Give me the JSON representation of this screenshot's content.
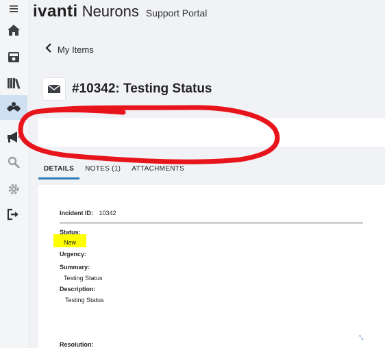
{
  "header": {
    "logo_text": "ivanti",
    "product": "Neurons",
    "portal": "Support Portal"
  },
  "nav": {
    "back_label": "My Items"
  },
  "incident": {
    "title": "#10342: Testing Status",
    "id_label": "Incident ID:",
    "id_value": "10342",
    "status_label": "Status:",
    "status_value": "New",
    "urgency_label": "Urgency:",
    "summary_label": "Summary:",
    "summary_value": "Testing Status",
    "description_label": "Description:",
    "description_value": "Testing Status",
    "resolution_label": "Resolution:"
  },
  "tabs": [
    {
      "label": "DETAILS",
      "active": true
    },
    {
      "label": "NOTES (1)",
      "active": false
    },
    {
      "label": "ATTACHMENTS",
      "active": false
    }
  ],
  "icons": {
    "menu": "hamburger-icon",
    "home": "home-icon",
    "inbox": "inbox-icon",
    "library": "library-icon",
    "hands": "service-hands-icon",
    "announce": "megaphone-icon",
    "search": "search-icon",
    "settings": "gear-icon",
    "logout": "logout-icon",
    "mail": "envelope-icon",
    "back": "chevron-left-icon"
  },
  "colors": {
    "annotation": "#e8141c",
    "highlight": "#ffff00",
    "active_tab": "#2b7bb9",
    "active_nav": "#cfe0f2"
  }
}
